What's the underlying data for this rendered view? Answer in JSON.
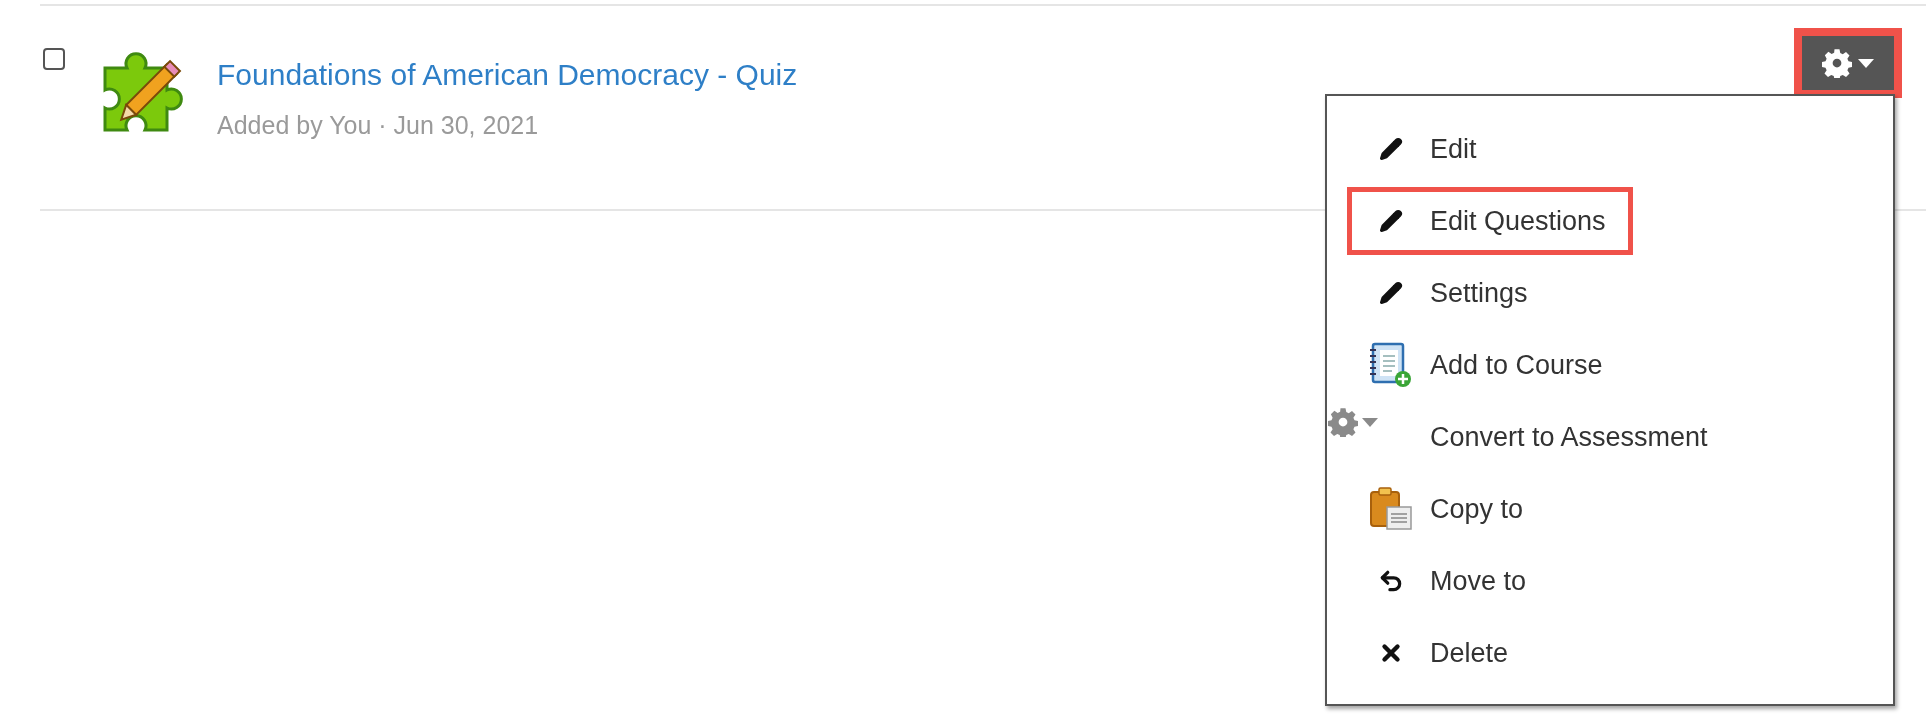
{
  "item": {
    "checked": false,
    "title": "Foundations of American Democracy - Quiz",
    "meta": "Added by You · Jun 30, 2021"
  },
  "gear_button": {
    "highlighted": true,
    "expanded": true
  },
  "menu": [
    {
      "label": "Edit",
      "kind": "pencil",
      "highlighted": false
    },
    {
      "label": "Edit Questions",
      "kind": "pencil",
      "highlighted": true
    },
    {
      "label": "Settings",
      "kind": "pencil",
      "highlighted": false
    },
    {
      "label": "Add to Course",
      "kind": "notebook",
      "highlighted": false
    },
    {
      "label": "Convert to Assessment",
      "kind": "plain",
      "highlighted": false
    },
    {
      "label": "Copy to",
      "kind": "clipboard",
      "highlighted": false
    },
    {
      "label": "Move to",
      "kind": "undo",
      "highlighted": false
    },
    {
      "label": "Delete",
      "kind": "delete",
      "highlighted": false
    }
  ]
}
